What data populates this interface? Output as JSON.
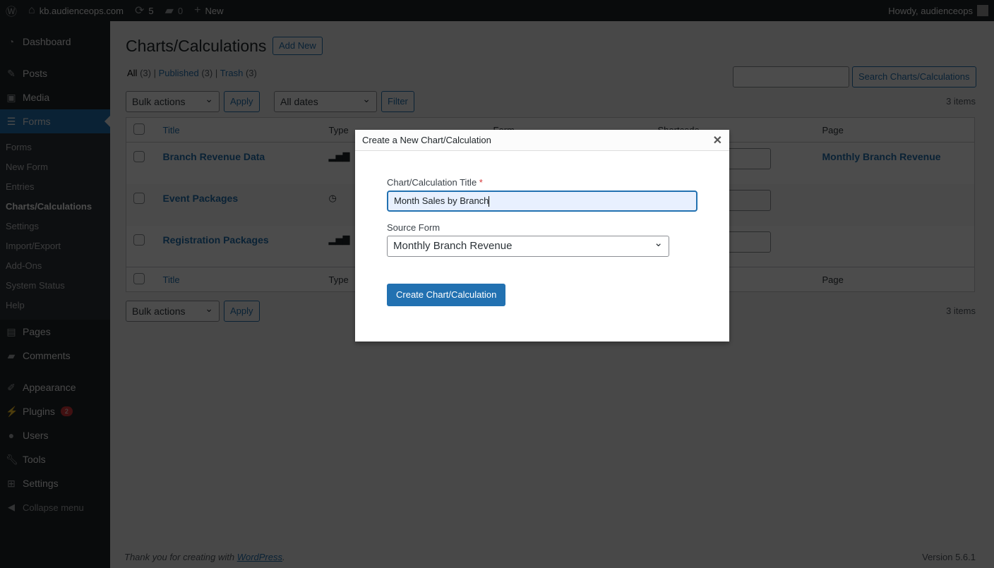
{
  "adminbar": {
    "site": "kb.audienceops.com",
    "updates": "5",
    "comments": "0",
    "new": "New",
    "howdy": "Howdy, audienceops"
  },
  "sidebar": {
    "items": [
      {
        "label": "Dashboard",
        "icon": "dashboard-icon"
      },
      {
        "label": "Posts",
        "icon": "pin-icon"
      },
      {
        "label": "Media",
        "icon": "media-icon"
      },
      {
        "label": "Forms",
        "icon": "forms-icon"
      },
      {
        "label": "Pages",
        "icon": "pages-icon"
      },
      {
        "label": "Comments",
        "icon": "comment-icon"
      },
      {
        "label": "Appearance",
        "icon": "brush-icon"
      },
      {
        "label": "Plugins",
        "icon": "plugin-icon",
        "badge": "2"
      },
      {
        "label": "Users",
        "icon": "user-icon"
      },
      {
        "label": "Tools",
        "icon": "wrench-icon"
      },
      {
        "label": "Settings",
        "icon": "settings-icon"
      },
      {
        "label": "Collapse menu",
        "icon": "collapse-icon"
      }
    ],
    "submenu": [
      "Forms",
      "New Form",
      "Entries",
      "Charts/Calculations",
      "Settings",
      "Import/Export",
      "Add-Ons",
      "System Status",
      "Help"
    ]
  },
  "page": {
    "title": "Charts/Calculations",
    "add_new": "Add New",
    "filters": {
      "all": "All",
      "all_count": "(3)",
      "published": "Published",
      "published_count": "(3)",
      "trash": "Trash",
      "trash_count": "(3)"
    },
    "search_button": "Search Charts/Calculations",
    "search_value": "",
    "bulk": "Bulk actions",
    "apply": "Apply",
    "dates": "All dates",
    "filter": "Filter",
    "items": "3 items",
    "columns": [
      "Title",
      "Type",
      "Form",
      "Shortcode",
      "Page"
    ],
    "rows": [
      {
        "title": "Branch Revenue Data",
        "type": "bar-chart-icon",
        "page": "Monthly Branch Revenue"
      },
      {
        "title": "Event Packages",
        "type": "clock-icon",
        "page": ""
      },
      {
        "title": "Registration Packages",
        "type": "bar-chart-icon",
        "page": ""
      }
    ],
    "footer_text": "Thank you for creating with ",
    "footer_link": "WordPress",
    "version": "Version 5.6.1"
  },
  "modal": {
    "title": "Create a New Chart/Calculation",
    "title_label": "Chart/Calculation Title",
    "required": "*",
    "title_value": "Month Sales by Branch",
    "source_label": "Source Form",
    "source_value": "Monthly Branch Revenue",
    "submit": "Create Chart/Calculation"
  },
  "colors": {
    "accent": "#2271b1",
    "sidebar": "#1d2327"
  }
}
